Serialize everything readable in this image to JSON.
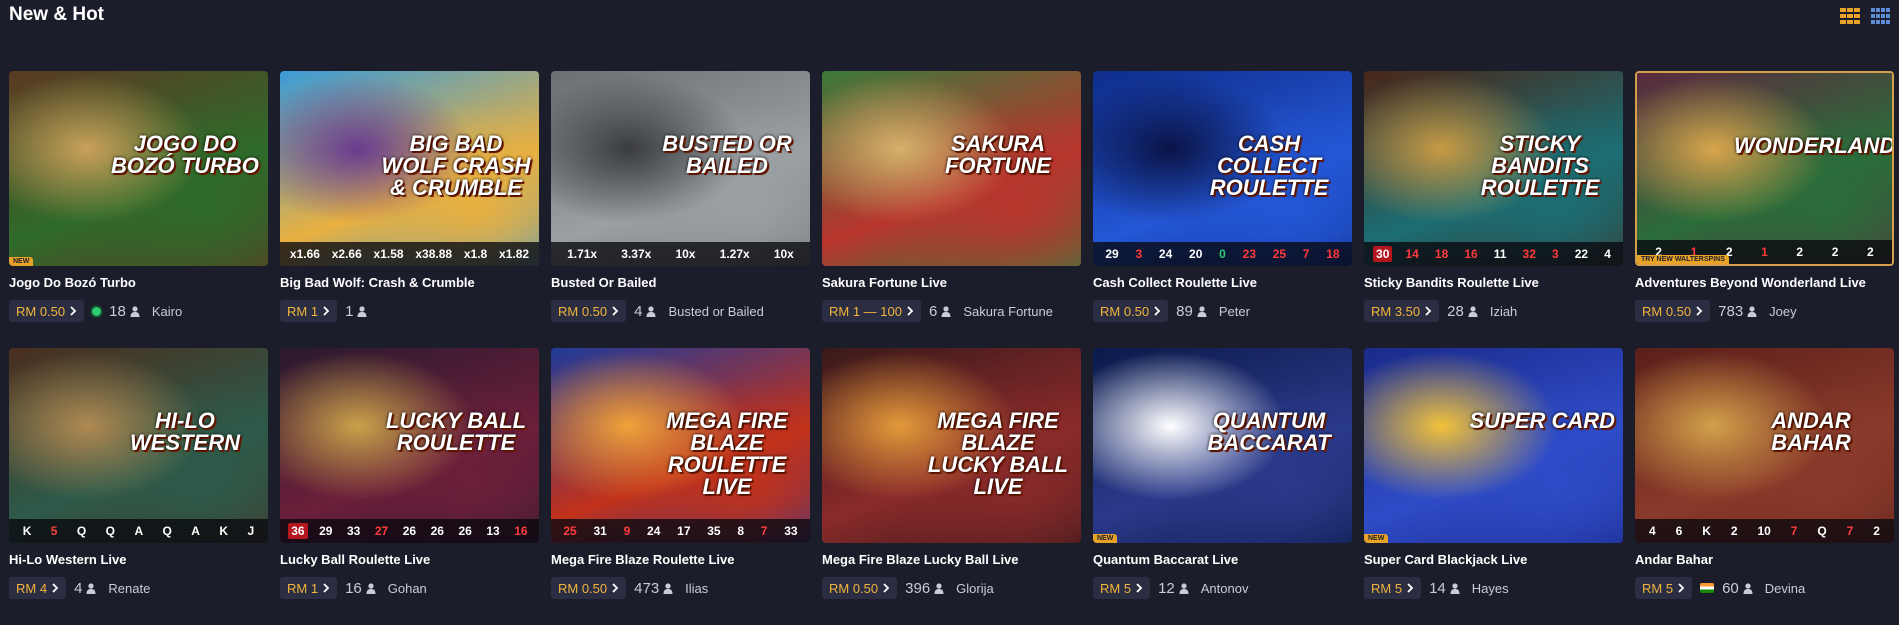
{
  "header": {
    "title": "New & Hot"
  },
  "view_icons": [
    {
      "name": "grid-large-icon",
      "color": "#e8a227"
    },
    {
      "name": "grid-small-icon",
      "color": "#5b8ed6"
    }
  ],
  "games": [
    {
      "name": "Jogo Do Bozó Turbo",
      "bet": "RM 0.50",
      "players": "18",
      "dealer": "Kairo",
      "badge": "NEW",
      "logo": "JOGO DO BOZÓ TURBO",
      "colors": [
        "#5a3a22",
        "#2f6b2a",
        "#c9a15a"
      ],
      "live": true,
      "results": [],
      "active": false
    },
    {
      "name": "Big Bad Wolf: Crash & Crumble",
      "bet": "RM 1",
      "players": "1",
      "dealer": "",
      "badge": "",
      "logo": "BIG BAD WOLF CRASH & CRUMBLE",
      "colors": [
        "#3b9bd8",
        "#e8b040",
        "#6a3b8f"
      ],
      "results": [
        "x1.66",
        "x2.66",
        "x1.58",
        "x38.88",
        "x1.8",
        "x1.82"
      ],
      "active": false
    },
    {
      "name": "Busted Or Bailed",
      "bet": "RM 0.50",
      "players": "4",
      "dealer": "Busted or Bailed",
      "badge": "",
      "logo": "BUSTED OR BAILED",
      "colors": [
        "#6c6f72",
        "#9aa0a3",
        "#3a3c40"
      ],
      "results": [
        "1.71x",
        "3.37x",
        "10x",
        "1.27x",
        "10x"
      ],
      "active": false
    },
    {
      "name": "Sakura Fortune Live",
      "bet": "RM 1 — 100",
      "players": "6",
      "dealer": "Sakura Fortune",
      "badge": "",
      "logo": "SAKURA FORTUNE",
      "colors": [
        "#3b7a3a",
        "#b8352e",
        "#d5b16a"
      ],
      "results": [],
      "active": false
    },
    {
      "name": "Cash Collect Roulette Live",
      "bet": "RM 0.50",
      "players": "89",
      "dealer": "Peter",
      "badge": "",
      "logo": "CASH COLLECT ROULETTE",
      "colors": [
        "#0f2d8a",
        "#2457d6",
        "#0a1447"
      ],
      "results": [
        "29",
        "3",
        "24",
        "20",
        "0",
        "23",
        "25",
        "7",
        "18"
      ],
      "active": false
    },
    {
      "name": "Sticky Bandits Roulette Live",
      "bet": "RM 3.50",
      "players": "28",
      "dealer": "Iziah",
      "badge": "",
      "logo": "STICKY BANDITS ROULETTE",
      "colors": [
        "#4a2618",
        "#1b6e74",
        "#c79a44"
      ],
      "results": [
        "30",
        "14",
        "18",
        "16",
        "11",
        "32",
        "3",
        "22",
        "4"
      ],
      "active": false
    },
    {
      "name": "Adventures Beyond Wonderland Live",
      "bet": "RM 0.50",
      "players": "783",
      "dealer": "Joey",
      "badge": "TRY NEW WALTERSPINS",
      "logo": "WONDERLAND",
      "colors": [
        "#5b2a3e",
        "#2b6d3a",
        "#d8a54c"
      ],
      "results": [
        "2",
        "1",
        "2",
        "1",
        "2",
        "2",
        "2"
      ],
      "active": true
    },
    {
      "name": "Hi-Lo Western Live",
      "bet": "RM 4",
      "players": "4",
      "dealer": "Renate",
      "badge": "",
      "logo": "HI-LO WESTERN",
      "colors": [
        "#4a2e1e",
        "#2d5a4a",
        "#b08a52"
      ],
      "results": [
        "K",
        "5",
        "Q",
        "Q",
        "A",
        "Q",
        "A",
        "K",
        "J"
      ],
      "active": false
    },
    {
      "name": "Lucky Ball Roulette Live",
      "bet": "RM 1",
      "players": "16",
      "dealer": "Gohan",
      "badge": "",
      "logo": "LUCKY BALL ROULETTE",
      "colors": [
        "#2a1a2e",
        "#6b1f3a",
        "#c9a24a"
      ],
      "results": [
        "36",
        "29",
        "33",
        "27",
        "26",
        "26",
        "26",
        "13",
        "16"
      ],
      "active": false
    },
    {
      "name": "Mega Fire Blaze Roulette Live",
      "bet": "RM 0.50",
      "players": "473",
      "dealer": "Ilias",
      "badge": "",
      "logo": "MEGA FIRE BLAZE ROULETTE LIVE",
      "colors": [
        "#1f3a9a",
        "#c2311a",
        "#f0a23a"
      ],
      "results": [
        "25",
        "31",
        "9",
        "24",
        "17",
        "35",
        "8",
        "7",
        "33"
      ],
      "active": false
    },
    {
      "name": "Mega Fire Blaze Lucky Ball Live",
      "bet": "RM 0.50",
      "players": "396",
      "dealer": "Glorija",
      "badge": "",
      "logo": "MEGA FIRE BLAZE LUCKY BALL LIVE",
      "colors": [
        "#3a1a1a",
        "#8a2a2a",
        "#e39a3a"
      ],
      "results": [],
      "active": false
    },
    {
      "name": "Quantum Baccarat Live",
      "bet": "RM 5",
      "players": "12",
      "dealer": "Antonov",
      "badge": "NEW",
      "logo": "QUANTUM BACCARAT",
      "colors": [
        "#0b1a4a",
        "#2a3a8a",
        "#ffffff"
      ],
      "results": [],
      "active": false
    },
    {
      "name": "Super Card Blackjack Live",
      "bet": "RM 5",
      "players": "14",
      "dealer": "Hayes",
      "badge": "NEW",
      "logo": "SUPER CARD",
      "colors": [
        "#1a2a8a",
        "#2f4cc8",
        "#f2c23a"
      ],
      "results": [],
      "active": false
    },
    {
      "name": "Andar Bahar",
      "bet": "RM 5",
      "players": "60",
      "dealer": "Devina",
      "badge": "",
      "logo": "ANDAR BAHAR",
      "colors": [
        "#5a1f1a",
        "#8a3a2a",
        "#d2a14a"
      ],
      "flag": true,
      "results": [
        "4",
        "6",
        "K",
        "2",
        "10",
        "7",
        "Q",
        "7",
        "2"
      ],
      "active": false
    }
  ]
}
